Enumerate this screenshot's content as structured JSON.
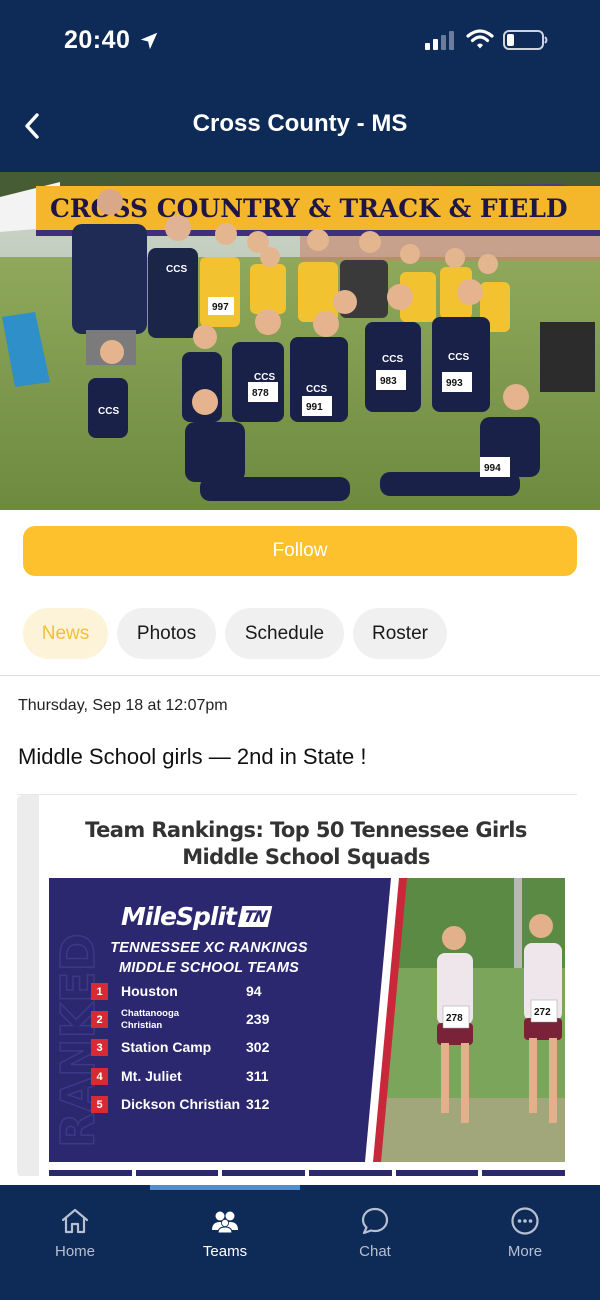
{
  "status_bar": {
    "time": "20:40"
  },
  "header": {
    "title": "Cross County - MS"
  },
  "hero": {
    "banner_text": "CROSS COUNTRY & TRACK & FIELD",
    "bib_numbers": [
      "997",
      "983",
      "993",
      "878",
      "991",
      "994"
    ],
    "shirt_text": "CCS"
  },
  "follow": {
    "label": "Follow"
  },
  "tabs": [
    {
      "label": "News",
      "active": true
    },
    {
      "label": "Photos",
      "active": false
    },
    {
      "label": "Schedule",
      "active": false
    },
    {
      "label": "Roster",
      "active": false
    }
  ],
  "post": {
    "date": "Thursday, Sep 18 at 12:07pm",
    "title": "Middle School girls — 2nd in State !",
    "card": {
      "headline": "Team Rankings: Top 50 Tennessee Girls Middle School Squads",
      "logo": "MileSplit",
      "logo_tag": "TN",
      "subtitle_line1": "TENNESSEE XC RANKINGS",
      "subtitle_line2": "MIDDLE SCHOOL TEAMS",
      "side_word": "RANKED",
      "rankings": [
        {
          "rank": "1",
          "team": "Houston",
          "score": "94"
        },
        {
          "rank": "2",
          "team": "Chattanooga Christian",
          "score": "239"
        },
        {
          "rank": "3",
          "team": "Station Camp",
          "score": "302"
        },
        {
          "rank": "4",
          "team": "Mt. Juliet",
          "score": "311"
        },
        {
          "rank": "5",
          "team": "Dickson Christian",
          "score": "312"
        }
      ],
      "runner_bibs": [
        "278",
        "272"
      ]
    }
  },
  "bottom_nav": [
    {
      "label": "Home",
      "icon": "home-icon",
      "active": false
    },
    {
      "label": "Teams",
      "icon": "teams-icon",
      "active": true
    },
    {
      "label": "Chat",
      "icon": "chat-icon",
      "active": false
    },
    {
      "label": "More",
      "icon": "more-icon",
      "active": false
    }
  ],
  "colors": {
    "header_bg": "#0e2a57",
    "follow_bg": "#fcc12d",
    "tab_active_text": "#f3bf3c",
    "tab_active_bg": "#fdf3d8",
    "ranking_bg": "#2b2870",
    "rank_badge": "#d82a32"
  }
}
